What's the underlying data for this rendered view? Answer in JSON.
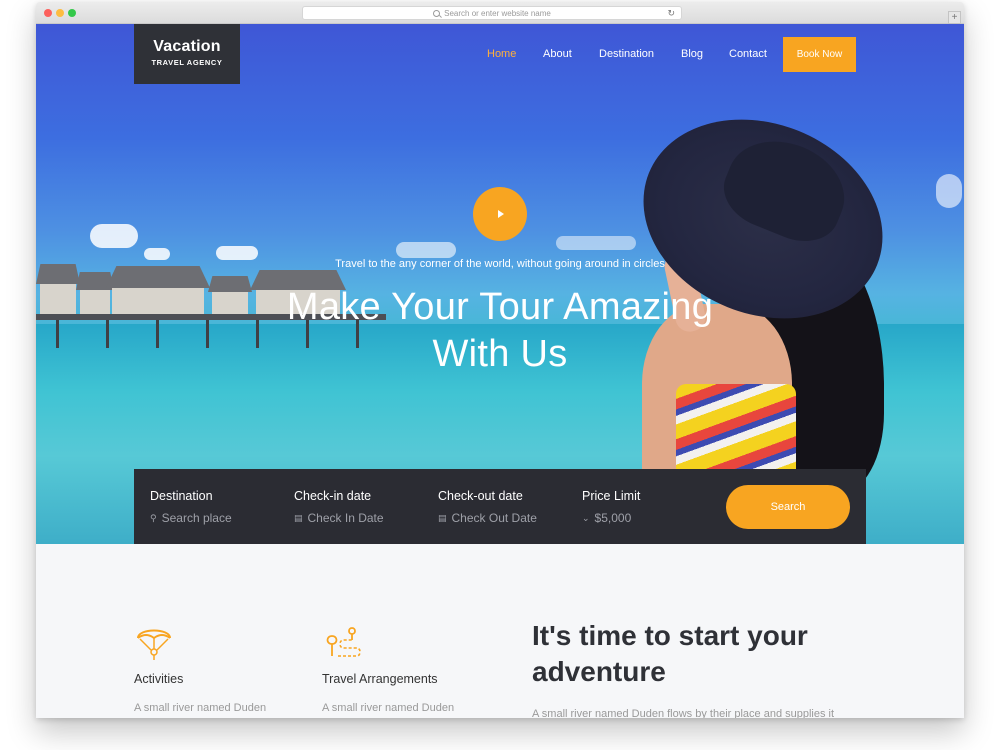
{
  "browser": {
    "address_placeholder": "Search or enter website name",
    "reload_icon": "reload-icon",
    "new_tab_label": "+"
  },
  "brand": {
    "title": "Vacation",
    "subtitle": "TRAVEL AGENCY"
  },
  "nav": {
    "items": [
      {
        "label": "Home",
        "active": true
      },
      {
        "label": "About",
        "active": false
      },
      {
        "label": "Destination",
        "active": false
      },
      {
        "label": "Blog",
        "active": false
      },
      {
        "label": "Contact",
        "active": false
      }
    ],
    "cta": "Book Now"
  },
  "hero": {
    "tagline": "Travel to the any corner of the world, without going around in circles",
    "headline_line1": "Make Your Tour Amazing",
    "headline_line2": "With Us",
    "play_icon": "play-icon"
  },
  "search": {
    "fields": [
      {
        "label": "Destination",
        "value": "Search place",
        "icon": "search-icon"
      },
      {
        "label": "Check-in date",
        "value": "Check In Date",
        "icon": "calendar-icon"
      },
      {
        "label": "Check-out date",
        "value": "Check Out Date",
        "icon": "calendar-icon"
      },
      {
        "label": "Price Limit",
        "value": "$5,000",
        "icon": "chevron-down-icon"
      }
    ],
    "button": "Search"
  },
  "features": [
    {
      "title": "Activities",
      "text": "A small river named Duden",
      "icon": "parachute-icon"
    },
    {
      "title": "Travel Arrangements",
      "text": "A small river named Duden",
      "icon": "route-pin-icon"
    }
  ],
  "adventure": {
    "title_line1": "It's time to start your",
    "title_line2": "adventure",
    "text": "A small river named Duden flows by their place and supplies it"
  },
  "colors": {
    "accent": "#f8a521",
    "dark": "#2b2c33",
    "hero_blue": "#3d6ee0"
  }
}
